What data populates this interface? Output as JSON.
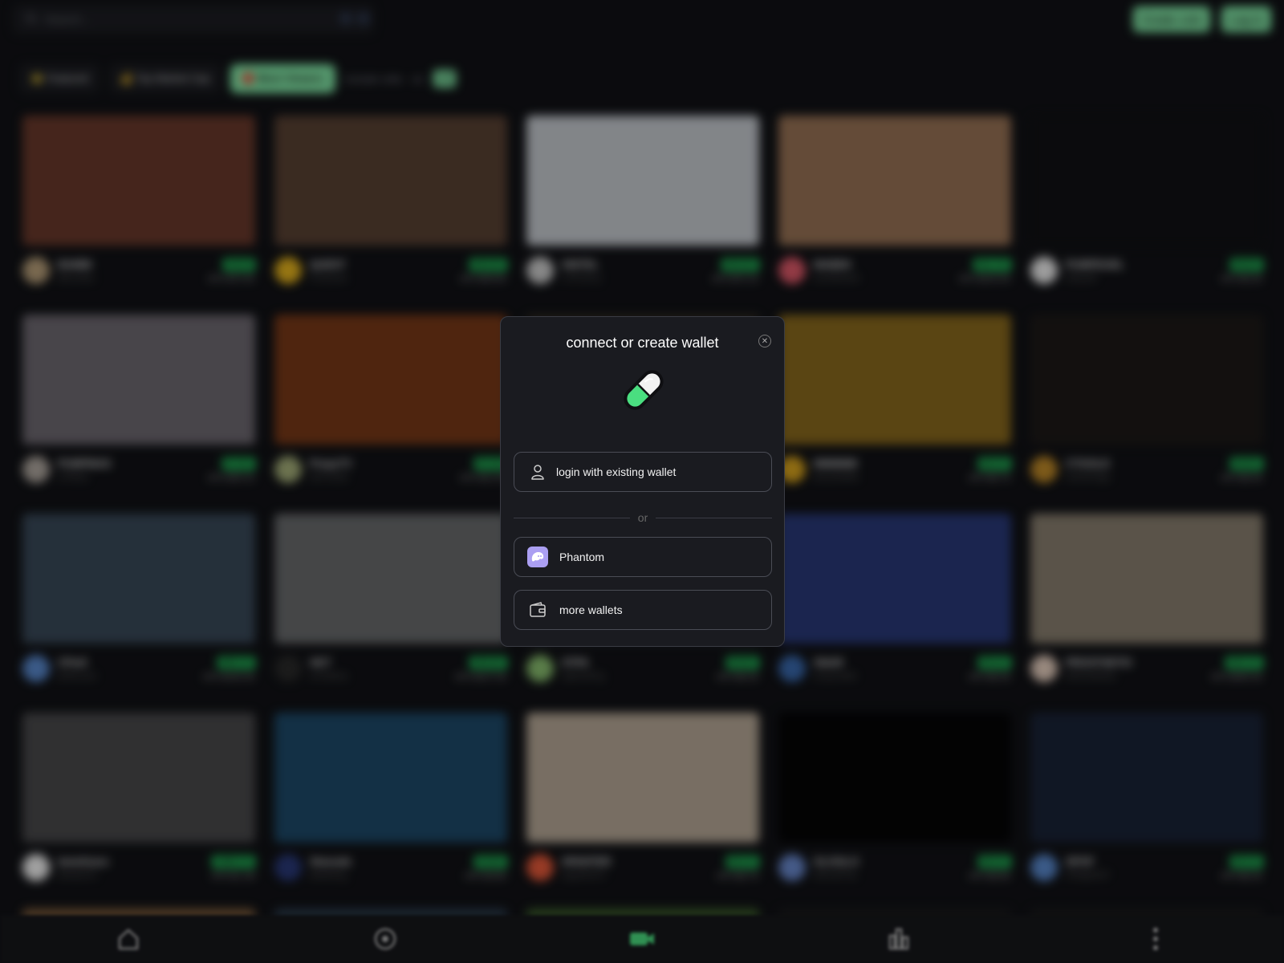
{
  "search": {
    "placeholder": "Search..."
  },
  "header": {
    "create_coin": "Create coin",
    "log_in": "Log in"
  },
  "filters": [
    {
      "label": "⭐ Featured",
      "active": false
    },
    {
      "label": "💰 Top Market Cap",
      "active": false
    },
    {
      "label": "🔴 Most Viewers",
      "active": true
    }
  ],
  "include_nsfw": {
    "label": "include nsfw",
    "value": "on",
    "toggle": "off"
  },
  "streams": [
    {
      "symbol": "BAMBI",
      "name": "Bitcoinbe",
      "price": "$0.00",
      "ath": "ATH $70.4K",
      "avatar_color": "#b9a07a",
      "thumb": "#6b3a2c"
    },
    {
      "symbol": "QUEST",
      "name": "Productio",
      "price": "$20.0K",
      "ath": "ATH $49.6K",
      "avatar_color": "#e6b41e",
      "thumb": "#5a4234"
    },
    {
      "symbol": "SINTEL",
      "name": "STEVemy",
      "price": "$25.0K",
      "ath": "ATH $70.1K",
      "avatar_color": "#cfcfcf",
      "thumb": "#c8ccd2"
    },
    {
      "symbol": "MABEK",
      "name": "loneWestsh",
      "price": "$21.7K",
      "ath": "ATH $103.0K",
      "avatar_color": "#e05a6a",
      "thumb": "#9a7456"
    },
    {
      "symbol": "PUMPDUEL",
      "name": "Dlhyraff",
      "price": "$9.2K",
      "ath": "ATH $3.2K",
      "avatar_color": "#f0f0f0",
      "thumb": "#111214"
    },
    {
      "symbol": "PUMPMAS",
      "name": "CPMaS",
      "price": "$7.0K",
      "ath": "ATH $35.1K",
      "avatar_color": "#b0a8a0",
      "thumb": "#6f6a72"
    },
    {
      "symbol": "PrepyTV",
      "name": "diChrsaiS",
      "price": "$7.3K",
      "ath": "ATH $12.0K",
      "avatar_color": "#a6b07a",
      "thumb": "#7a3a18"
    },
    {
      "symbol": "",
      "name": "",
      "price": "",
      "ath": "",
      "avatar_color": "#8a7a6a",
      "thumb": "#302a22"
    },
    {
      "symbol": "MMMMM",
      "name": "Bosstr9MM",
      "price": "$6.7K",
      "ath": "ATH $6.7K",
      "avatar_color": "#d9a41e",
      "thumb": "#8a6a1e"
    },
    {
      "symbol": "CTGOLD",
      "name": "GoDoKAge",
      "price": "$6.0K",
      "ath": "ATH $6.0K",
      "avatar_color": "#c08a28",
      "thumb": "#1e1a18"
    },
    {
      "symbol": "CPwS",
      "name": "BnMLwsh",
      "price": "$85.7K",
      "ath": "ATH $146.3K",
      "avatar_color": "#5a8acf",
      "thumb": "#3a4a5a"
    },
    {
      "symbol": "HKT",
      "name": "ATIAMHa",
      "price": "$59.9K",
      "ath": "ATH $137.4K",
      "avatar_color": "#2a2a2a",
      "thumb": "#6a6c6e"
    },
    {
      "symbol": "STPA",
      "name": "SplmehFig",
      "price": "$5.0K",
      "ath": "ATH $6.2K",
      "avatar_color": "#8ac070",
      "thumb": "#2a2c34"
    },
    {
      "symbol": "SNAR",
      "name": "DXyeuNMr",
      "price": "$5.1K",
      "ath": "ATH $6.4K",
      "avatar_color": "#3a6aaf",
      "thumb": "#2a3a7a"
    },
    {
      "symbol": "PROSTHETIC",
      "name": "6RGHeMSte",
      "price": "$25.7K",
      "ath": "ATH $265.2K",
      "avatar_color": "#e8d0c0",
      "thumb": "#8a8070"
    },
    {
      "symbol": "Iamelizaro",
      "name": "Ba4taoX5",
      "price": "$389.7K",
      "ath": "ATH $1.1M",
      "avatar_color": "#f5f5f5",
      "thumb": "#4a4a4c"
    },
    {
      "symbol": "Steezale",
      "name": "Beitlo9ng",
      "price": "$3.8K",
      "ath": "ATH $3.8K",
      "avatar_color": "#2a3a7a",
      "thumb": "#1e4a6a"
    },
    {
      "symbol": "SPANTER",
      "name": "ApyEwKST",
      "price": "$5.7K",
      "ath": "ATH $6.7K",
      "avatar_color": "#e85a3a",
      "thumb": "#b8aa98"
    },
    {
      "symbol": "GLOGLO",
      "name": "tKEXaFXle",
      "price": "$6.7K",
      "ath": "ATH $6.8K",
      "avatar_color": "#6a8acf",
      "thumb": "#050506"
    },
    {
      "symbol": "SPOF",
      "name": "PRNjeDKP",
      "price": "$5.7K",
      "ath": "ATH $6.2K",
      "avatar_color": "#5a8acf",
      "thumb": "#1a2438"
    }
  ],
  "bottom_row_colors": [
    "#7a5a3a",
    "#2a3a4a",
    "#3a5a2a",
    "#1a1a1c",
    "#1a1a1c"
  ],
  "nav": [
    {
      "icon": "home-icon"
    },
    {
      "icon": "circle-dot-icon"
    },
    {
      "icon": "live-camera-icon"
    },
    {
      "icon": "chart-icon"
    },
    {
      "icon": "more-icon"
    }
  ],
  "modal": {
    "title": "connect or create wallet",
    "close_icon": "close-icon",
    "login_label": "login with existing wallet",
    "or_label": "or",
    "phantom_label": "Phantom",
    "more_wallets_label": "more wallets",
    "accent": "#4ade80"
  }
}
